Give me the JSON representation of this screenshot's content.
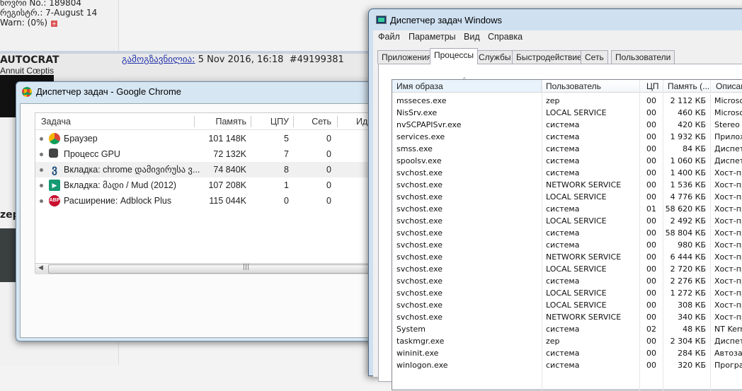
{
  "forum": {
    "profile_lines": [
      "ნოვრი No.: 189804",
      "რეგისტრ.: 7-August 14",
      "Warn: (0%)"
    ],
    "post_author": "AUTOCRAT",
    "post_author_subtitle": "Annuit Cœptis",
    "post_link": "გამოგზავნილია:",
    "post_date": "5 Nov 2016, 16:18",
    "post_number": "#49199381",
    "second_author": "zep"
  },
  "chrome_tm": {
    "title": "Диспетчер задач - Google Chrome",
    "columns": [
      "Задача",
      "Память",
      "ЦПУ",
      "Сеть",
      "Иде"
    ],
    "rows": [
      {
        "icon": "chrome-icon",
        "task": "Браузер",
        "memory": "101 148K",
        "cpu": "5",
        "net": "0"
      },
      {
        "icon": "puzzle-icon",
        "task": "Процесс GPU",
        "memory": "72 132K",
        "cpu": "7",
        "net": "0"
      },
      {
        "icon": "georgian-site-icon",
        "task": "Вкладка: chrome დამივირუსა ვ...",
        "memory": "74 840K",
        "cpu": "8",
        "net": "0",
        "selected": true
      },
      {
        "icon": "video-icon",
        "task": "Вкладка: მადი / Mud (2012)",
        "memory": "107 208K",
        "cpu": "1",
        "net": "0"
      },
      {
        "icon": "adblock-icon",
        "task": "Расширение: Adblock Plus",
        "memory": "115 044K",
        "cpu": "0",
        "net": "0"
      }
    ]
  },
  "win_tm": {
    "title": "Диспетчер задач Windows",
    "menu": [
      "Файл",
      "Параметры",
      "Вид",
      "Справка"
    ],
    "tabs": [
      "Приложения",
      "Процессы",
      "Службы",
      "Быстродействие",
      "Сеть",
      "Пользователи"
    ],
    "active_tab": "Процессы",
    "columns": [
      "Имя образа",
      "Пользователь",
      "ЦП",
      "Память (...",
      "Описани"
    ],
    "rows": [
      [
        "msseces.exe",
        "zep",
        "00",
        "2 112 КБ",
        "Microsof"
      ],
      [
        "NisSrv.exe",
        "LOCAL SERVICE",
        "00",
        "460 КБ",
        "Microsof"
      ],
      [
        "nvSCPAPISvr.exe",
        "система",
        "00",
        "420 КБ",
        "Stereo V"
      ],
      [
        "services.exe",
        "система",
        "00",
        "1 932 КБ",
        "Прилож"
      ],
      [
        "smss.exe",
        "система",
        "00",
        "84 КБ",
        "Диспетч"
      ],
      [
        "spoolsv.exe",
        "система",
        "00",
        "1 060 КБ",
        "Диспетч"
      ],
      [
        "svchost.exe",
        "система",
        "00",
        "1 400 КБ",
        "Хост-пр"
      ],
      [
        "svchost.exe",
        "NETWORK SERVICE",
        "00",
        "1 536 КБ",
        "Хост-пр"
      ],
      [
        "svchost.exe",
        "LOCAL SERVICE",
        "00",
        "4 776 КБ",
        "Хост-пр"
      ],
      [
        "svchost.exe",
        "система",
        "01",
        "58 620 КБ",
        "Хост-пр"
      ],
      [
        "svchost.exe",
        "LOCAL SERVICE",
        "00",
        "2 492 КБ",
        "Хост-пр"
      ],
      [
        "svchost.exe",
        "система",
        "00",
        "58 804 КБ",
        "Хост-пр"
      ],
      [
        "svchost.exe",
        "система",
        "00",
        "980 КБ",
        "Хост-пр"
      ],
      [
        "svchost.exe",
        "NETWORK SERVICE",
        "00",
        "6 444 КБ",
        "Хост-пр"
      ],
      [
        "svchost.exe",
        "LOCAL SERVICE",
        "00",
        "2 720 КБ",
        "Хост-пр"
      ],
      [
        "svchost.exe",
        "система",
        "00",
        "2 276 КБ",
        "Хост-пр"
      ],
      [
        "svchost.exe",
        "LOCAL SERVICE",
        "00",
        "1 272 КБ",
        "Хост-пр"
      ],
      [
        "svchost.exe",
        "LOCAL SERVICE",
        "00",
        "308 КБ",
        "Хост-пр"
      ],
      [
        "svchost.exe",
        "NETWORK SERVICE",
        "00",
        "340 КБ",
        "Хост-пр"
      ],
      [
        "System",
        "система",
        "02",
        "48 КБ",
        "NT Kerne"
      ],
      [
        "taskmgr.exe",
        "zep",
        "00",
        "2 304 КБ",
        "Диспетч"
      ],
      [
        "wininit.exe",
        "система",
        "00",
        "284 КБ",
        "Автозаг"
      ],
      [
        "winlogon.exe",
        "система",
        "00",
        "320 КБ",
        "Програм"
      ]
    ]
  }
}
